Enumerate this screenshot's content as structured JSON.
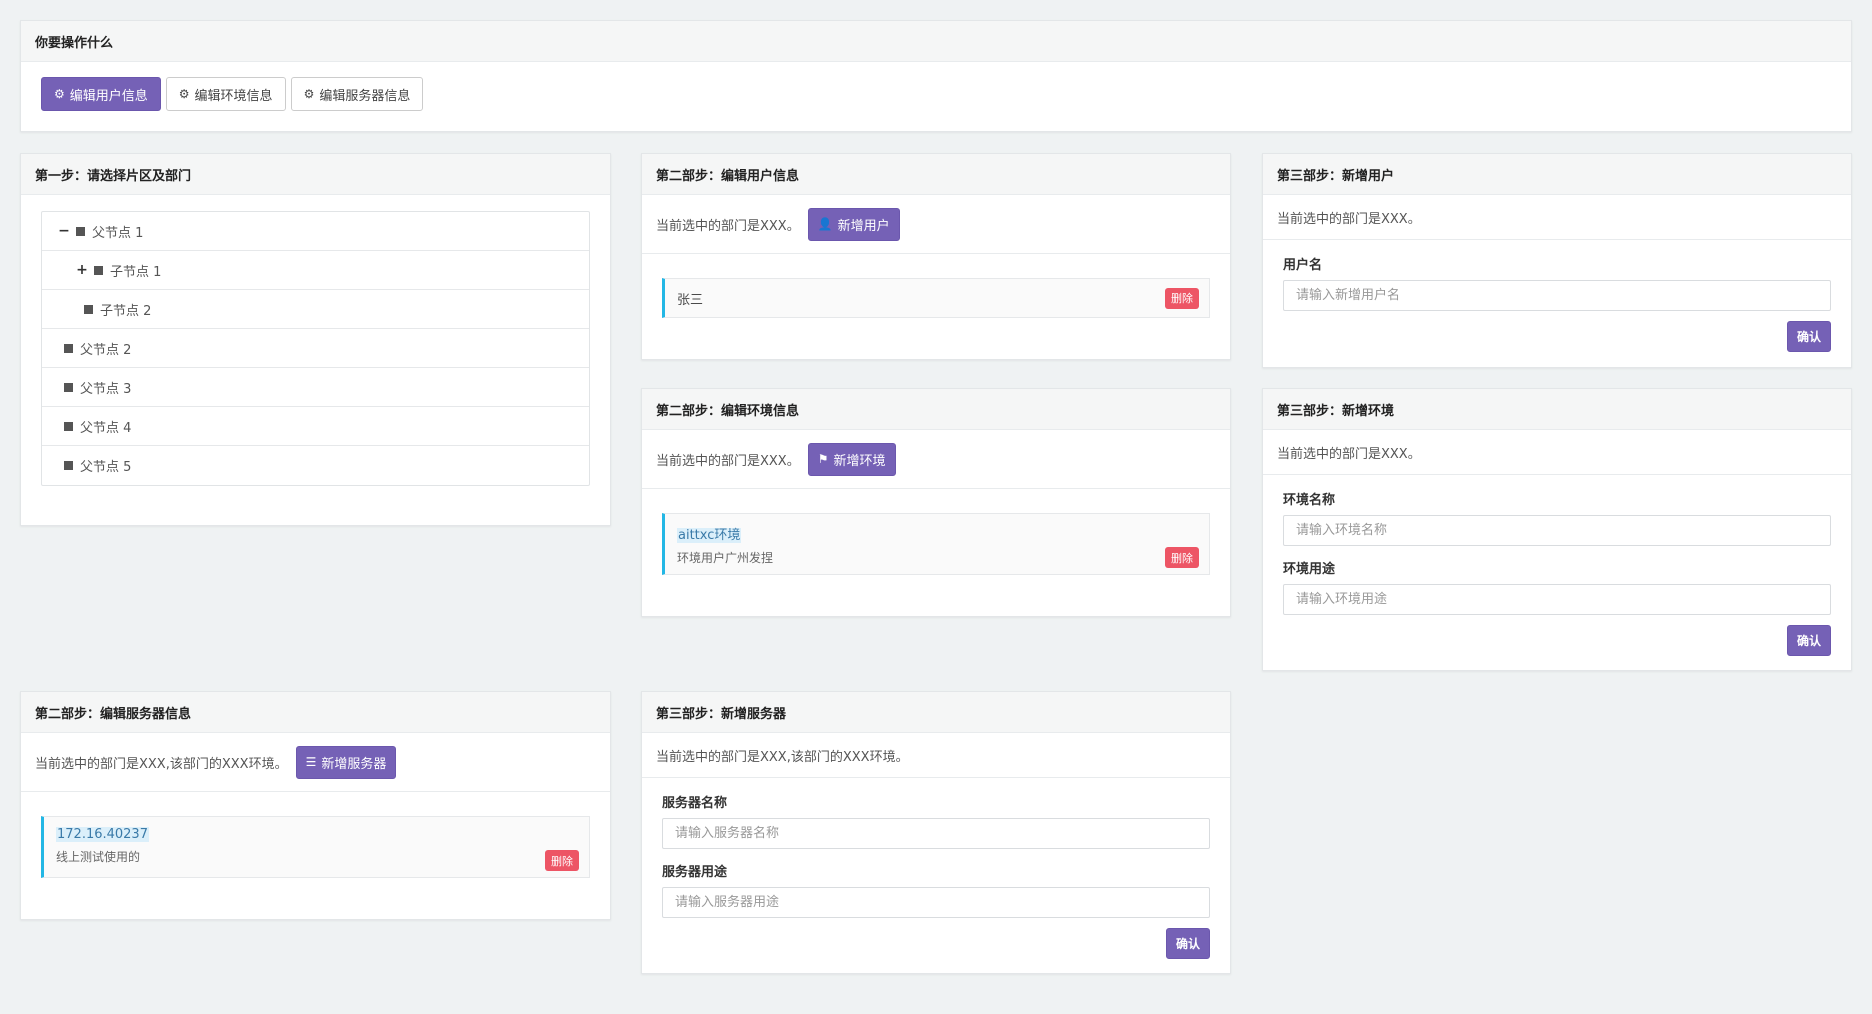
{
  "top_panel": {
    "title": "你要操作什么",
    "buttons": [
      {
        "label": "编辑用户信息",
        "icon": "gears-icon",
        "active": true
      },
      {
        "label": "编辑环境信息",
        "icon": "gears-icon",
        "active": false
      },
      {
        "label": "编辑服务器信息",
        "icon": "gears-icon",
        "active": false
      }
    ]
  },
  "step1": {
    "title": "第一步：请选择片区及部门",
    "tree": [
      {
        "label": "父节点 1",
        "toggle": "−",
        "level": 0
      },
      {
        "label": "子节点 1",
        "toggle": "+",
        "level": 1
      },
      {
        "label": "子节点 2",
        "toggle": "",
        "level": 1
      },
      {
        "label": "父节点 2",
        "toggle": "",
        "level": 0
      },
      {
        "label": "父节点 3",
        "toggle": "",
        "level": 0
      },
      {
        "label": "父节点 4",
        "toggle": "",
        "level": 0
      },
      {
        "label": "父节点 5",
        "toggle": "",
        "level": 0
      }
    ]
  },
  "edit_user": {
    "title": "第二部步：编辑用户信息",
    "current": "当前选中的部门是XXX。",
    "add_label": "新增用户",
    "items": [
      {
        "title": "张三",
        "delete_label": "删除"
      }
    ]
  },
  "add_user": {
    "title": "第三部步：新增用户",
    "current": "当前选中的部门是XXX。",
    "field_label": "用户名",
    "field_placeholder": "请输入新增用户名",
    "confirm_label": "确认"
  },
  "edit_env": {
    "title": "第二部步：编辑环境信息",
    "current": "当前选中的部门是XXX。",
    "add_label": "新增环境",
    "items": [
      {
        "title": "aittxc环境",
        "desc": "环境用户广州发捏",
        "delete_label": "删除"
      }
    ]
  },
  "add_env": {
    "title": "第三部步：新增环境",
    "current": "当前选中的部门是XXX。",
    "name_label": "环境名称",
    "name_placeholder": "请输入环境名称",
    "purpose_label": "环境用途",
    "purpose_placeholder": "请输入环境用途",
    "confirm_label": "确认"
  },
  "edit_server": {
    "title": "第二部步：编辑服务器信息",
    "current": "当前选中的部门是XXX,该部门的XXX环境。",
    "add_label": "新增服务器",
    "items": [
      {
        "title": "172.16.40237",
        "desc": "线上测试使用的",
        "delete_label": "删除"
      }
    ]
  },
  "add_server": {
    "title": "第三部步：新增服务器",
    "current": "当前选中的部门是XXX,该部门的XXX环境。",
    "name_label": "服务器名称",
    "name_placeholder": "请输入服务器名称",
    "purpose_label": "服务器用途",
    "purpose_placeholder": "请输入服务器用途",
    "confirm_label": "确认"
  },
  "colors": {
    "primary": "#7561b6",
    "danger": "#ed5565",
    "accent": "#23b7e5",
    "background": "#eff2f3"
  }
}
